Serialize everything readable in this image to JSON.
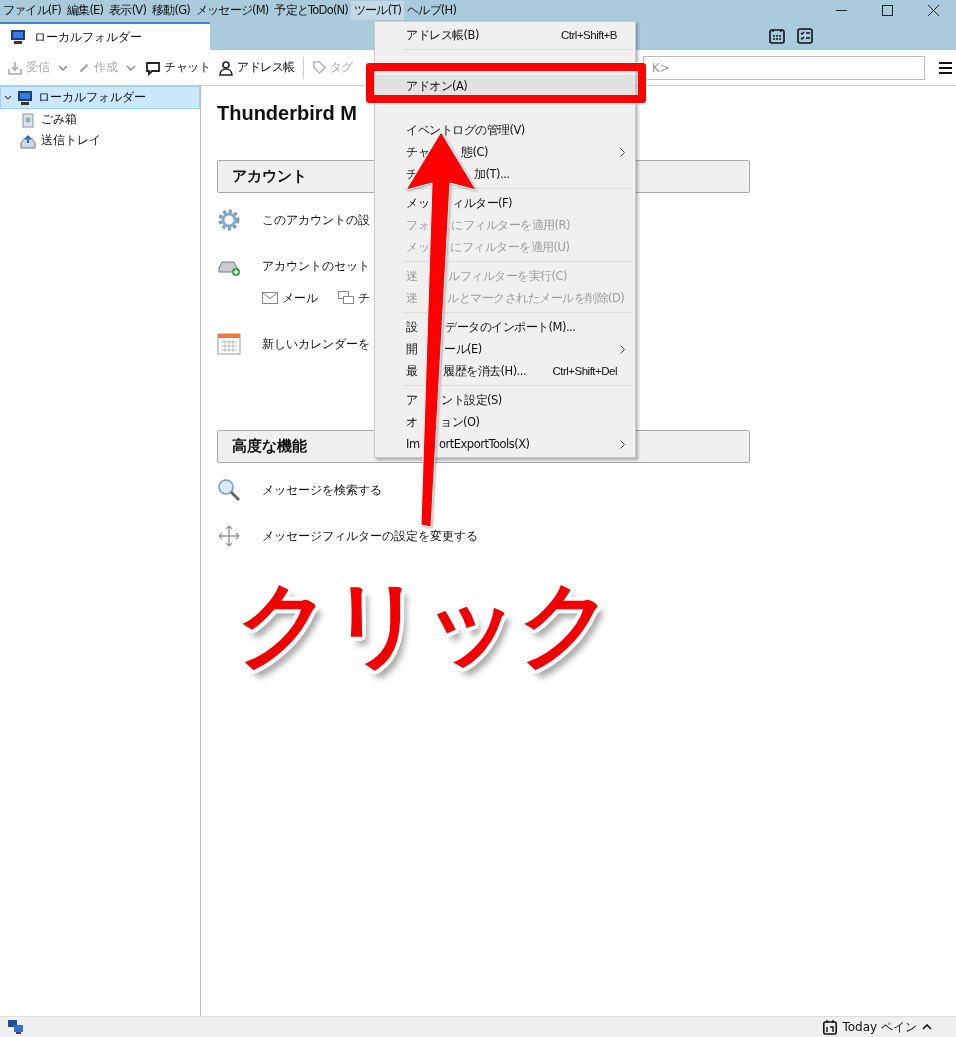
{
  "menubar": [
    {
      "label": "ファイル(F)",
      "selected": false
    },
    {
      "label": "編集(E)",
      "selected": false
    },
    {
      "label": "表示(V)",
      "selected": false
    },
    {
      "label": "移動(G)",
      "selected": false
    },
    {
      "label": "メッセージ(M)",
      "selected": false
    },
    {
      "label": "予定とToDo(N)",
      "selected": false
    },
    {
      "label": "ツール(T)",
      "selected": true
    },
    {
      "label": "ヘルプ(H)",
      "selected": false
    }
  ],
  "tabs": [
    {
      "label": "ローカルフォルダー",
      "selected": true
    }
  ],
  "toolbar": [
    {
      "kind": "get",
      "label": "受信",
      "disabled": true,
      "dropdown": true
    },
    {
      "kind": "write",
      "label": "作成",
      "disabled": true,
      "dropdown": true
    },
    {
      "kind": "chat",
      "label": "チャット",
      "disabled": false,
      "dropdown": false
    },
    {
      "kind": "address",
      "label": "アドレス帳",
      "disabled": false,
      "dropdown": false
    },
    {
      "kind": "tag",
      "label": "タグ",
      "disabled": true,
      "dropdown": false
    }
  ],
  "search": {
    "placeholder": "K>"
  },
  "folders": [
    {
      "kind": "computer",
      "label": "ローカルフォルダー",
      "selected": true,
      "expanded": true,
      "children": [
        {
          "kind": "trash",
          "label": "ごみ箱",
          "selected": false
        },
        {
          "kind": "outbox",
          "label": "送信トレイ",
          "selected": false
        }
      ]
    }
  ],
  "content": {
    "title": "Thunderbird M",
    "sections": [
      {
        "heading": "アカウント",
        "items": [
          {
            "kind": "gear",
            "label": "このアカウントの設"
          },
          {
            "kind": "account",
            "label": "アカウントのセット",
            "links": [
              {
                "kind": "mail",
                "label": "メール"
              },
              {
                "kind": "chat",
                "label": "チ"
              }
            ]
          },
          {
            "kind": "calendar",
            "label": "新しいカレンダーを"
          }
        ]
      },
      {
        "heading": "高度な機能",
        "items": [
          {
            "kind": "search",
            "label": "メッセージを検索する"
          },
          {
            "kind": "filter",
            "label": "メッセージフィルターの設定を変更する"
          }
        ]
      }
    ]
  },
  "tools_menu": [
    {
      "kind": "item",
      "label_parts": [
        "アドレス帳(B)"
      ],
      "shortcut": "Ctrl+Shift+B",
      "disabled": false,
      "selected": false,
      "submenu": false
    },
    {
      "kind": "separator"
    },
    {
      "kind": "covered"
    },
    {
      "kind": "item",
      "label_parts": [
        "アドオン(A)"
      ],
      "disabled": false,
      "selected": true,
      "submenu": false
    },
    {
      "kind": "covered"
    },
    {
      "kind": "item",
      "label_parts": [
        "イベントログの管理(V)"
      ],
      "disabled": false,
      "selected": false,
      "submenu": false
    },
    {
      "kind": "item",
      "label_parts": [
        "チャ",
        "態(C)"
      ],
      "disabled": false,
      "selected": false,
      "submenu": true
    },
    {
      "kind": "item",
      "label_parts": [
        "チ",
        "加(T)..."
      ],
      "disabled": false,
      "selected": false,
      "submenu": false
    },
    {
      "kind": "separator"
    },
    {
      "kind": "item",
      "label_parts": [
        "メッ",
        "ィルター(F)"
      ],
      "disabled": false,
      "selected": false,
      "submenu": false
    },
    {
      "kind": "item",
      "label_parts": [
        "フォ",
        "にフィルターを適用(R)"
      ],
      "disabled": true,
      "selected": false,
      "submenu": false
    },
    {
      "kind": "item",
      "label_parts": [
        "メッ",
        "にフィルターを適用(U)"
      ],
      "disabled": true,
      "selected": false,
      "submenu": false
    },
    {
      "kind": "separator"
    },
    {
      "kind": "item",
      "label_parts": [
        "迷",
        "ルフィルターを実行(C)"
      ],
      "disabled": true,
      "selected": false,
      "submenu": false
    },
    {
      "kind": "item",
      "label_parts": [
        "迷",
        "ルとマークされたメールを削除(D)"
      ],
      "disabled": true,
      "selected": false,
      "submenu": false
    },
    {
      "kind": "separator"
    },
    {
      "kind": "item",
      "label_parts": [
        "設",
        "データのインポート(M)..."
      ],
      "disabled": false,
      "selected": false,
      "submenu": false
    },
    {
      "kind": "item",
      "label_parts": [
        "開",
        "ール(E)"
      ],
      "disabled": false,
      "selected": false,
      "submenu": true
    },
    {
      "kind": "item",
      "label_parts": [
        "最",
        "履歴を消去(H)..."
      ],
      "shortcut": "Ctrl+Shift+Del",
      "disabled": false,
      "selected": false,
      "submenu": false
    },
    {
      "kind": "separator"
    },
    {
      "kind": "item",
      "label_parts": [
        "ア",
        "ント設定(S)"
      ],
      "disabled": false,
      "selected": false,
      "submenu": false
    },
    {
      "kind": "item",
      "label_parts": [
        "オ",
        "ョン(O)"
      ],
      "disabled": false,
      "selected": false,
      "submenu": false
    },
    {
      "kind": "item",
      "label_parts": [
        "Im",
        "ortExportTools(X)"
      ],
      "disabled": false,
      "selected": false,
      "submenu": true
    }
  ],
  "status_bar": {
    "today_pane": "Today ペイン"
  },
  "annotation": {
    "label": "クリック"
  }
}
